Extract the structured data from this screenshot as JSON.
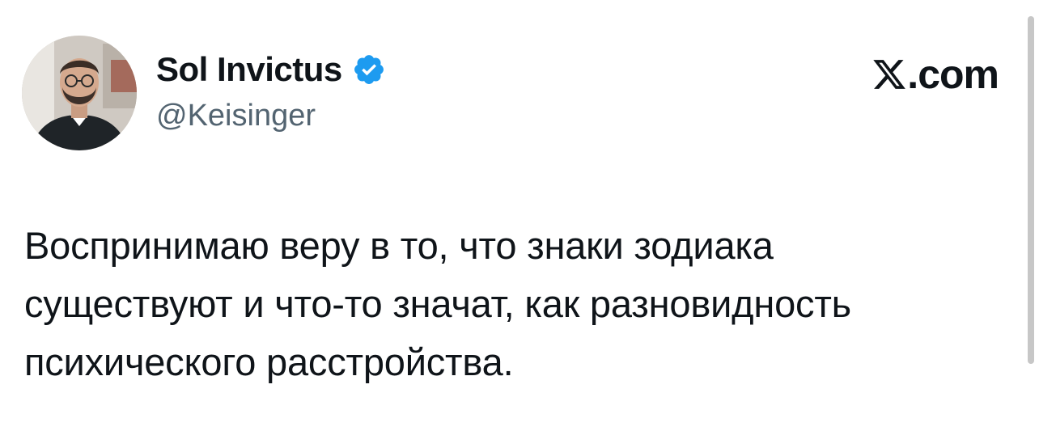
{
  "tweet": {
    "author_name": "Sol Invictus",
    "handle": "@Keisinger",
    "verified": true,
    "text": "Воспринимаю веру в то, что знаки зодиака\nсуществуют и что-то значат, как разновидность\nпсихического расстройства."
  },
  "brand": {
    "text": ".com",
    "icon": "x-logo-icon"
  },
  "colors": {
    "text_primary": "#0f1419",
    "text_secondary": "#536471",
    "verified_blue": "#1d9bf0",
    "background": "#ffffff"
  }
}
